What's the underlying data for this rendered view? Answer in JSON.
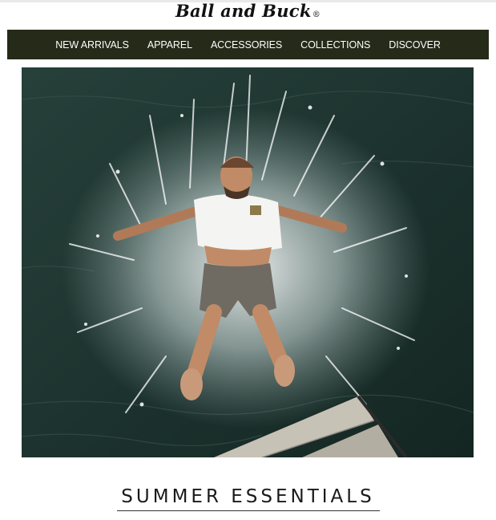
{
  "brand": {
    "logo_text": "Ball and Buck",
    "registered_mark": "®"
  },
  "nav": {
    "items": [
      {
        "label": "NEW ARRIVALS"
      },
      {
        "label": "APPAREL"
      },
      {
        "label": "ACCESSORIES"
      },
      {
        "label": "COLLECTIONS"
      },
      {
        "label": "DISCOVER"
      }
    ],
    "background_color": "#262a19"
  },
  "hero": {
    "image_subject": "man-splashing-into-lake-off-dock"
  },
  "section": {
    "heading": "SUMMER ESSENTIALS"
  }
}
